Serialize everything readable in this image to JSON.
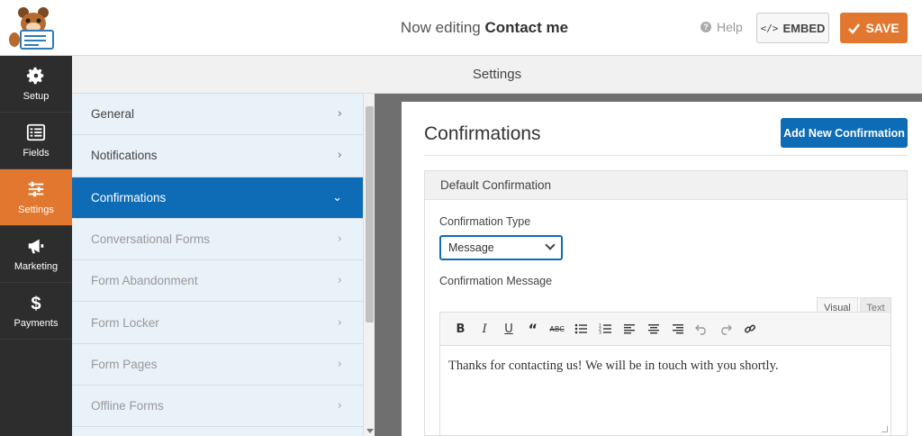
{
  "header": {
    "editing_prefix": "Now editing",
    "form_name": "Contact me",
    "help_label": "Help",
    "embed_label": "EMBED",
    "save_label": "SAVE"
  },
  "leftnav": {
    "items": [
      {
        "label": "Setup",
        "icon": "gear-icon",
        "active": false
      },
      {
        "label": "Fields",
        "icon": "fields-list-icon",
        "active": false
      },
      {
        "label": "Settings",
        "icon": "sliders-icon",
        "active": true
      },
      {
        "label": "Marketing",
        "icon": "megaphone-icon",
        "active": false
      },
      {
        "label": "Payments",
        "icon": "dollar-icon",
        "active": false
      }
    ]
  },
  "settings_header": "Settings",
  "panel": {
    "items": [
      {
        "label": "General",
        "state": "normal"
      },
      {
        "label": "Notifications",
        "state": "normal"
      },
      {
        "label": "Confirmations",
        "state": "active"
      },
      {
        "label": "Conversational Forms",
        "state": "disabled"
      },
      {
        "label": "Form Abandonment",
        "state": "disabled"
      },
      {
        "label": "Form Locker",
        "state": "disabled"
      },
      {
        "label": "Form Pages",
        "state": "disabled"
      },
      {
        "label": "Offline Forms",
        "state": "disabled"
      }
    ]
  },
  "content": {
    "title": "Confirmations",
    "add_button": "Add New Confirmation",
    "box_title": "Default Confirmation",
    "type_label": "Confirmation Type",
    "type_value": "Message",
    "message_label": "Confirmation Message",
    "tab_visual": "Visual",
    "tab_text": "Text",
    "message_text": "Thanks for contacting us! We will be in touch with you shortly."
  },
  "colors": {
    "accent_orange": "#e27730",
    "accent_blue": "#0e6bb5",
    "sidebar_dark": "#2d2d2d"
  }
}
